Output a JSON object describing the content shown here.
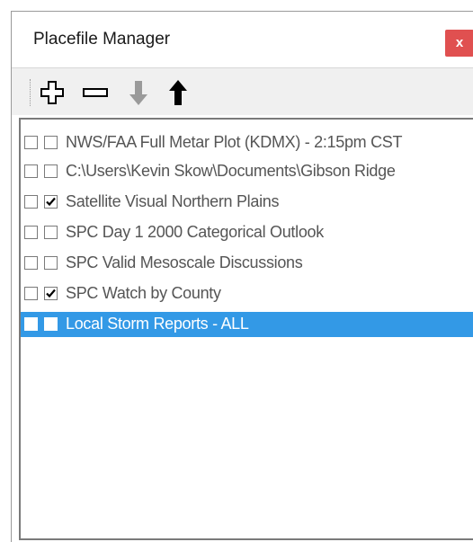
{
  "window": {
    "title": "Placefile Manager",
    "close_label": "x"
  },
  "toolbar": {
    "buttons": [
      {
        "name": "add-icon",
        "enabled": true
      },
      {
        "name": "remove-icon",
        "enabled": true
      },
      {
        "name": "move-down-icon",
        "enabled": false
      },
      {
        "name": "move-up-icon",
        "enabled": true
      }
    ]
  },
  "list": {
    "items": [
      {
        "label": "NWS/FAA Full Metar Plot (KDMX) - 2:15pm CST",
        "checked_1": false,
        "checked_2": false,
        "selected": false
      },
      {
        "label": "C:\\Users\\Kevin Skow\\Documents\\Gibson Ridge",
        "checked_1": false,
        "checked_2": false,
        "selected": false
      },
      {
        "label": "Satellite Visual Northern Plains",
        "checked_1": false,
        "checked_2": true,
        "selected": false
      },
      {
        "label": "SPC Day 1 2000 Categorical Outlook",
        "checked_1": false,
        "checked_2": false,
        "selected": false
      },
      {
        "label": "SPC Valid Mesoscale Discussions",
        "checked_1": false,
        "checked_2": false,
        "selected": false
      },
      {
        "label": "SPC Watch by County",
        "checked_1": false,
        "checked_2": true,
        "selected": false
      },
      {
        "label": "Local Storm Reports - ALL",
        "checked_1": false,
        "checked_2": false,
        "selected": true
      }
    ]
  },
  "colors": {
    "selection": "#3399e6",
    "close_button": "#e05050"
  }
}
